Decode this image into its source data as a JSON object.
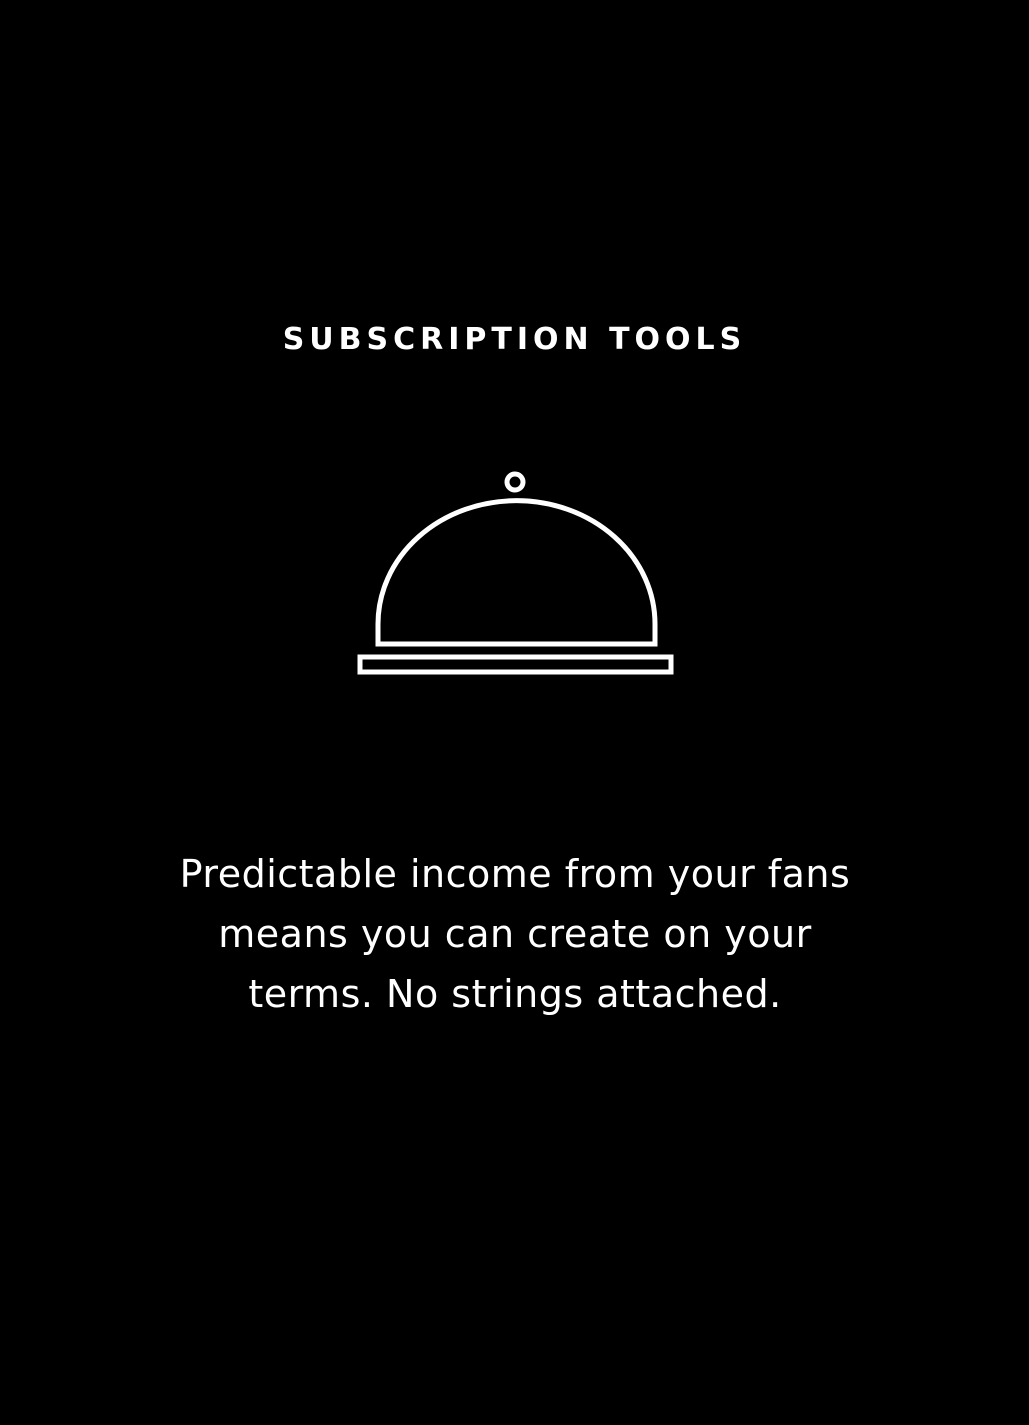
{
  "screen": {
    "background_color": "#000000",
    "text_color": "#ffffff"
  },
  "header": {
    "title": "SUBSCRIPTION TOOLS"
  },
  "feature_icon": {
    "name": "serving-cloche-icon"
  },
  "body": {
    "lines": [
      "Predictable income from your fans",
      "means you can create on your",
      "terms. No strings attached."
    ]
  }
}
